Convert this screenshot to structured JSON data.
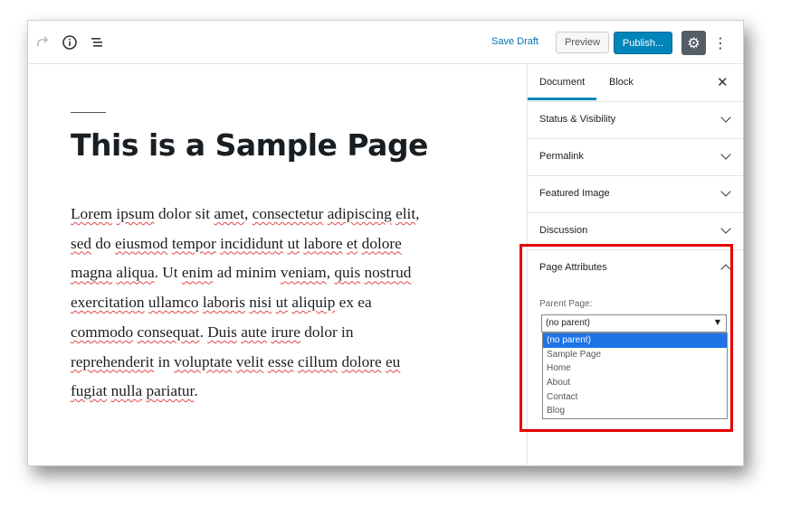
{
  "toolbar": {
    "redo_icon": "redo-icon",
    "info_icon": "info-icon",
    "outline_icon": "list-icon",
    "save_draft": "Save Draft",
    "preview": "Preview",
    "publish": "Publish...",
    "settings_icon": "gear-icon",
    "more_icon": "vertical-ellipsis-icon"
  },
  "editor": {
    "title": "This is a Sample Page",
    "body_segments": [
      {
        "text": " ",
        "misspelled": false
      },
      {
        "text": "Lorem",
        "misspelled": true
      },
      {
        "text": " ",
        "misspelled": false
      },
      {
        "text": "ipsum",
        "misspelled": true
      },
      {
        "text": " dolor sit ",
        "misspelled": false
      },
      {
        "text": "amet",
        "misspelled": true
      },
      {
        "text": ", ",
        "misspelled": false
      },
      {
        "text": "consectetur",
        "misspelled": true
      },
      {
        "text": " ",
        "misspelled": false
      },
      {
        "text": "adipiscing",
        "misspelled": true
      },
      {
        "text": " ",
        "misspelled": false
      },
      {
        "text": "elit",
        "misspelled": true
      },
      {
        "text": ", ",
        "misspelled": false
      },
      {
        "text": "sed",
        "misspelled": true
      },
      {
        "text": " do ",
        "misspelled": false
      },
      {
        "text": "eiusmod",
        "misspelled": true
      },
      {
        "text": " ",
        "misspelled": false
      },
      {
        "text": "tempor",
        "misspelled": true
      },
      {
        "text": " ",
        "misspelled": false
      },
      {
        "text": "incididunt",
        "misspelled": true
      },
      {
        "text": " ",
        "misspelled": false
      },
      {
        "text": "ut",
        "misspelled": true
      },
      {
        "text": " ",
        "misspelled": false
      },
      {
        "text": "labore",
        "misspelled": true
      },
      {
        "text": " ",
        "misspelled": false
      },
      {
        "text": "et",
        "misspelled": true
      },
      {
        "text": " ",
        "misspelled": false
      },
      {
        "text": "dolore",
        "misspelled": true
      },
      {
        "text": " ",
        "misspelled": false
      },
      {
        "text": "magna",
        "misspelled": true
      },
      {
        "text": " ",
        "misspelled": false
      },
      {
        "text": "aliqua",
        "misspelled": true
      },
      {
        "text": ". Ut ",
        "misspelled": false
      },
      {
        "text": "enim",
        "misspelled": true
      },
      {
        "text": " ad minim ",
        "misspelled": false
      },
      {
        "text": "veniam",
        "misspelled": true
      },
      {
        "text": ", ",
        "misspelled": false
      },
      {
        "text": "quis",
        "misspelled": true
      },
      {
        "text": " ",
        "misspelled": false
      },
      {
        "text": "nostrud",
        "misspelled": true
      },
      {
        "text": " ",
        "misspelled": false
      },
      {
        "text": "exercitation",
        "misspelled": true
      },
      {
        "text": " ",
        "misspelled": false
      },
      {
        "text": "ullamco",
        "misspelled": true
      },
      {
        "text": " ",
        "misspelled": false
      },
      {
        "text": "laboris",
        "misspelled": true
      },
      {
        "text": " ",
        "misspelled": false
      },
      {
        "text": "nisi",
        "misspelled": true
      },
      {
        "text": " ",
        "misspelled": false
      },
      {
        "text": "ut",
        "misspelled": true
      },
      {
        "text": " ",
        "misspelled": false
      },
      {
        "text": "aliquip",
        "misspelled": true
      },
      {
        "text": " ex ea ",
        "misspelled": false
      },
      {
        "text": "commodo",
        "misspelled": true
      },
      {
        "text": " ",
        "misspelled": false
      },
      {
        "text": "consequat",
        "misspelled": true
      },
      {
        "text": ". ",
        "misspelled": false
      },
      {
        "text": "Duis",
        "misspelled": true
      },
      {
        "text": " ",
        "misspelled": false
      },
      {
        "text": "aute",
        "misspelled": true
      },
      {
        "text": " ",
        "misspelled": false
      },
      {
        "text": "irure",
        "misspelled": true
      },
      {
        "text": " dolor in ",
        "misspelled": false
      },
      {
        "text": "reprehenderit",
        "misspelled": true
      },
      {
        "text": " in ",
        "misspelled": false
      },
      {
        "text": "voluptate",
        "misspelled": true
      },
      {
        "text": " ",
        "misspelled": false
      },
      {
        "text": "velit",
        "misspelled": true
      },
      {
        "text": " ",
        "misspelled": false
      },
      {
        "text": "esse",
        "misspelled": true
      },
      {
        "text": " ",
        "misspelled": false
      },
      {
        "text": "cillum",
        "misspelled": true
      },
      {
        "text": " ",
        "misspelled": false
      },
      {
        "text": "dolore",
        "misspelled": true
      },
      {
        "text": " ",
        "misspelled": false
      },
      {
        "text": "eu",
        "misspelled": true
      },
      {
        "text": " ",
        "misspelled": false
      },
      {
        "text": "fugiat",
        "misspelled": true
      },
      {
        "text": " ",
        "misspelled": false
      },
      {
        "text": "nulla",
        "misspelled": true
      },
      {
        "text": " ",
        "misspelled": false
      },
      {
        "text": "pariatur",
        "misspelled": true
      },
      {
        "text": ".",
        "misspelled": false
      }
    ]
  },
  "sidebar": {
    "tabs": [
      {
        "label": "Document"
      },
      {
        "label": "Block"
      }
    ],
    "close_icon": "close-icon",
    "panels": [
      {
        "label": "Status & Visibility"
      },
      {
        "label": "Permalink"
      },
      {
        "label": "Featured Image"
      },
      {
        "label": "Discussion"
      }
    ],
    "page_attributes": {
      "label": "Page Attributes",
      "parent_label": "Parent Page:",
      "selected": "(no parent)",
      "options": [
        "(no parent)",
        "Sample Page",
        "Home",
        "About",
        "Contact",
        "Blog"
      ]
    }
  },
  "colors": {
    "accent": "#0085ba",
    "highlight_box": "#e60000",
    "selected_option": "#1e73e6"
  }
}
